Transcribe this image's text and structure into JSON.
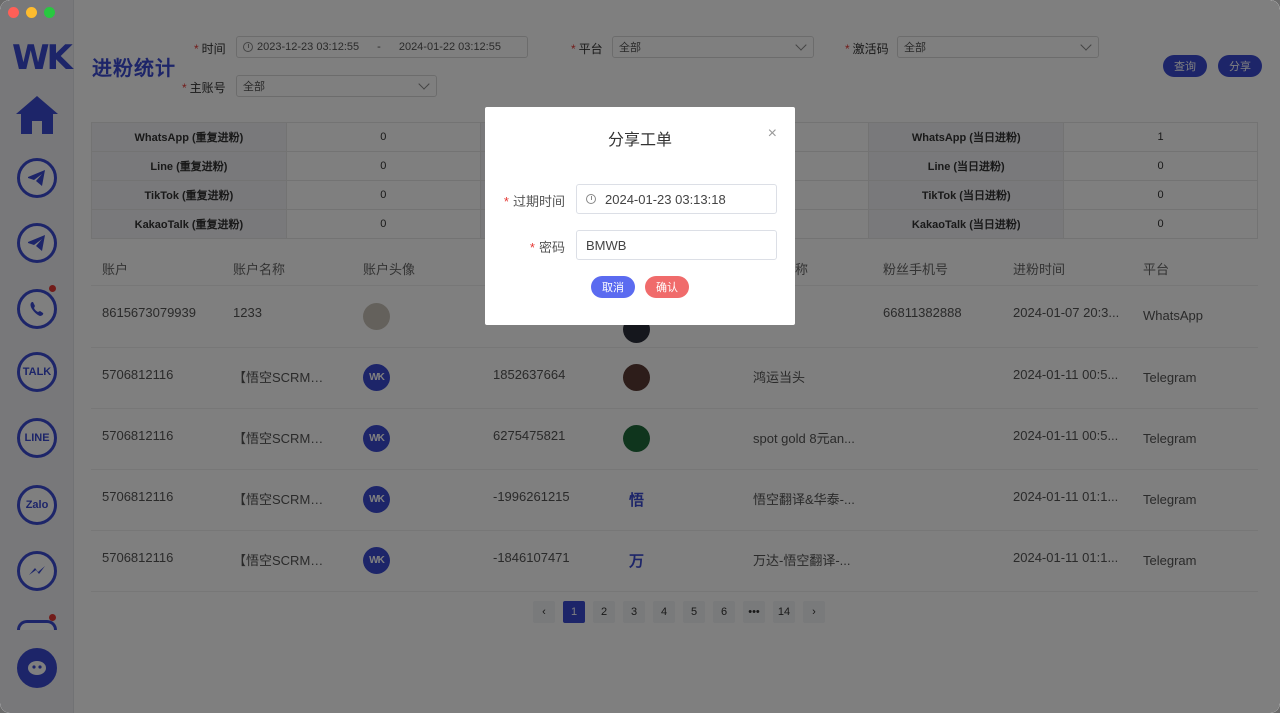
{
  "page": {
    "title": "进粉统计"
  },
  "filters": {
    "time_label": "时间",
    "start_time": "2023-12-23 03:12:55",
    "range_separator": "-",
    "end_time": "2024-01-22 03:12:55",
    "platform_label": "平台",
    "platform_value": "全部",
    "activation_label": "激活码",
    "activation_value": "全部",
    "main_account_label": "主账号",
    "main_account_value": "全部"
  },
  "actions": {
    "query": "查询",
    "share": "分享"
  },
  "stats": {
    "rows": [
      {
        "l1": "WhatsApp (重复进粉)",
        "v1": "0",
        "l3": "WhatsApp (当日进粉)",
        "v3": "1"
      },
      {
        "l1": "Line (重复进粉)",
        "v1": "0",
        "l3": "Line (当日进粉)",
        "v3": "0"
      },
      {
        "l1": "TikTok (重复进粉)",
        "v1": "0",
        "l3": "TikTok (当日进粉)",
        "v3": "0"
      },
      {
        "l1": "KakaoTalk (重复进粉)",
        "v1": "0",
        "l3": "KakaoTalk (当日进粉)",
        "v3": "0"
      }
    ]
  },
  "table": {
    "headers": {
      "account": "账户",
      "account_name": "账户名称",
      "account_avatar": "账户头像",
      "fan_name_tail": "称",
      "fan_phone": "粉丝手机号",
      "fan_time": "进粉时间",
      "platform": "平台"
    },
    "rows": [
      {
        "account": "8615673079939",
        "name": "1233",
        "fan_id": "",
        "fan_char": "",
        "fan_name": "",
        "phone": "66811382888",
        "time": "2024-01-07 20:3...",
        "platform": "WhatsApp"
      },
      {
        "account": "5706812116",
        "name": "【悟空SCRM】...",
        "fan_id": "1852637664",
        "fan_char": "",
        "fan_name": "鸿运当头",
        "phone": "",
        "time": "2024-01-11 00:5...",
        "platform": "Telegram"
      },
      {
        "account": "5706812116",
        "name": "【悟空SCRM】...",
        "fan_id": "6275475821",
        "fan_char": "",
        "fan_name": "spot gold 8元an...",
        "phone": "",
        "time": "2024-01-11 00:5...",
        "platform": "Telegram"
      },
      {
        "account": "5706812116",
        "name": "【悟空SCRM】...",
        "fan_id": "-1996261215",
        "fan_char": "悟",
        "fan_name": "悟空翻译&华泰-...",
        "phone": "",
        "time": "2024-01-11 01:1...",
        "platform": "Telegram"
      },
      {
        "account": "5706812116",
        "name": "【悟空SCRM】...",
        "fan_id": "-1846107471",
        "fan_char": "万",
        "fan_name": "万达-悟空翻译-...",
        "phone": "",
        "time": "2024-01-11 01:1...",
        "platform": "Telegram"
      }
    ],
    "wk_avatar_text": "WK"
  },
  "pagination": {
    "pages": [
      "1",
      "2",
      "3",
      "4",
      "5",
      "6",
      "•••",
      "14"
    ],
    "current": "1",
    "prev": "‹",
    "next": "›"
  },
  "sidebar": {
    "logo": "WK",
    "talk_label": "TALK",
    "line_label": "LINE",
    "zalo_label": "Zalo"
  },
  "modal": {
    "title": "分享工单",
    "close": "×",
    "expire_label": "过期时间",
    "expire_value": "2024-01-23 03:13:18",
    "password_label": "密码",
    "password_value": "BMWB",
    "cancel": "取消",
    "confirm": "确认"
  },
  "colors": {
    "accent": "#3b4bd3",
    "cancel": "#5b6bf0",
    "confirm": "#f06b6b"
  }
}
